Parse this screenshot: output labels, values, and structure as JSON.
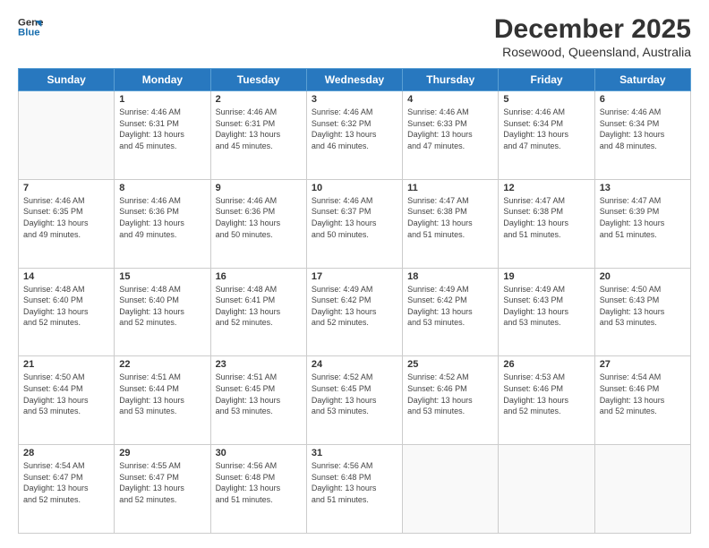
{
  "header": {
    "logo_line1": "General",
    "logo_line2": "Blue",
    "title": "December 2025",
    "subtitle": "Rosewood, Queensland, Australia"
  },
  "weekdays": [
    "Sunday",
    "Monday",
    "Tuesday",
    "Wednesday",
    "Thursday",
    "Friday",
    "Saturday"
  ],
  "weeks": [
    [
      {
        "day": "",
        "content": ""
      },
      {
        "day": "1",
        "content": "Sunrise: 4:46 AM\nSunset: 6:31 PM\nDaylight: 13 hours\nand 45 minutes."
      },
      {
        "day": "2",
        "content": "Sunrise: 4:46 AM\nSunset: 6:31 PM\nDaylight: 13 hours\nand 45 minutes."
      },
      {
        "day": "3",
        "content": "Sunrise: 4:46 AM\nSunset: 6:32 PM\nDaylight: 13 hours\nand 46 minutes."
      },
      {
        "day": "4",
        "content": "Sunrise: 4:46 AM\nSunset: 6:33 PM\nDaylight: 13 hours\nand 47 minutes."
      },
      {
        "day": "5",
        "content": "Sunrise: 4:46 AM\nSunset: 6:34 PM\nDaylight: 13 hours\nand 47 minutes."
      },
      {
        "day": "6",
        "content": "Sunrise: 4:46 AM\nSunset: 6:34 PM\nDaylight: 13 hours\nand 48 minutes."
      }
    ],
    [
      {
        "day": "7",
        "content": "Sunrise: 4:46 AM\nSunset: 6:35 PM\nDaylight: 13 hours\nand 49 minutes."
      },
      {
        "day": "8",
        "content": "Sunrise: 4:46 AM\nSunset: 6:36 PM\nDaylight: 13 hours\nand 49 minutes."
      },
      {
        "day": "9",
        "content": "Sunrise: 4:46 AM\nSunset: 6:36 PM\nDaylight: 13 hours\nand 50 minutes."
      },
      {
        "day": "10",
        "content": "Sunrise: 4:46 AM\nSunset: 6:37 PM\nDaylight: 13 hours\nand 50 minutes."
      },
      {
        "day": "11",
        "content": "Sunrise: 4:47 AM\nSunset: 6:38 PM\nDaylight: 13 hours\nand 51 minutes."
      },
      {
        "day": "12",
        "content": "Sunrise: 4:47 AM\nSunset: 6:38 PM\nDaylight: 13 hours\nand 51 minutes."
      },
      {
        "day": "13",
        "content": "Sunrise: 4:47 AM\nSunset: 6:39 PM\nDaylight: 13 hours\nand 51 minutes."
      }
    ],
    [
      {
        "day": "14",
        "content": "Sunrise: 4:48 AM\nSunset: 6:40 PM\nDaylight: 13 hours\nand 52 minutes."
      },
      {
        "day": "15",
        "content": "Sunrise: 4:48 AM\nSunset: 6:40 PM\nDaylight: 13 hours\nand 52 minutes."
      },
      {
        "day": "16",
        "content": "Sunrise: 4:48 AM\nSunset: 6:41 PM\nDaylight: 13 hours\nand 52 minutes."
      },
      {
        "day": "17",
        "content": "Sunrise: 4:49 AM\nSunset: 6:42 PM\nDaylight: 13 hours\nand 52 minutes."
      },
      {
        "day": "18",
        "content": "Sunrise: 4:49 AM\nSunset: 6:42 PM\nDaylight: 13 hours\nand 53 minutes."
      },
      {
        "day": "19",
        "content": "Sunrise: 4:49 AM\nSunset: 6:43 PM\nDaylight: 13 hours\nand 53 minutes."
      },
      {
        "day": "20",
        "content": "Sunrise: 4:50 AM\nSunset: 6:43 PM\nDaylight: 13 hours\nand 53 minutes."
      }
    ],
    [
      {
        "day": "21",
        "content": "Sunrise: 4:50 AM\nSunset: 6:44 PM\nDaylight: 13 hours\nand 53 minutes."
      },
      {
        "day": "22",
        "content": "Sunrise: 4:51 AM\nSunset: 6:44 PM\nDaylight: 13 hours\nand 53 minutes."
      },
      {
        "day": "23",
        "content": "Sunrise: 4:51 AM\nSunset: 6:45 PM\nDaylight: 13 hours\nand 53 minutes."
      },
      {
        "day": "24",
        "content": "Sunrise: 4:52 AM\nSunset: 6:45 PM\nDaylight: 13 hours\nand 53 minutes."
      },
      {
        "day": "25",
        "content": "Sunrise: 4:52 AM\nSunset: 6:46 PM\nDaylight: 13 hours\nand 53 minutes."
      },
      {
        "day": "26",
        "content": "Sunrise: 4:53 AM\nSunset: 6:46 PM\nDaylight: 13 hours\nand 52 minutes."
      },
      {
        "day": "27",
        "content": "Sunrise: 4:54 AM\nSunset: 6:46 PM\nDaylight: 13 hours\nand 52 minutes."
      }
    ],
    [
      {
        "day": "28",
        "content": "Sunrise: 4:54 AM\nSunset: 6:47 PM\nDaylight: 13 hours\nand 52 minutes."
      },
      {
        "day": "29",
        "content": "Sunrise: 4:55 AM\nSunset: 6:47 PM\nDaylight: 13 hours\nand 52 minutes."
      },
      {
        "day": "30",
        "content": "Sunrise: 4:56 AM\nSunset: 6:48 PM\nDaylight: 13 hours\nand 51 minutes."
      },
      {
        "day": "31",
        "content": "Sunrise: 4:56 AM\nSunset: 6:48 PM\nDaylight: 13 hours\nand 51 minutes."
      },
      {
        "day": "",
        "content": ""
      },
      {
        "day": "",
        "content": ""
      },
      {
        "day": "",
        "content": ""
      }
    ]
  ]
}
